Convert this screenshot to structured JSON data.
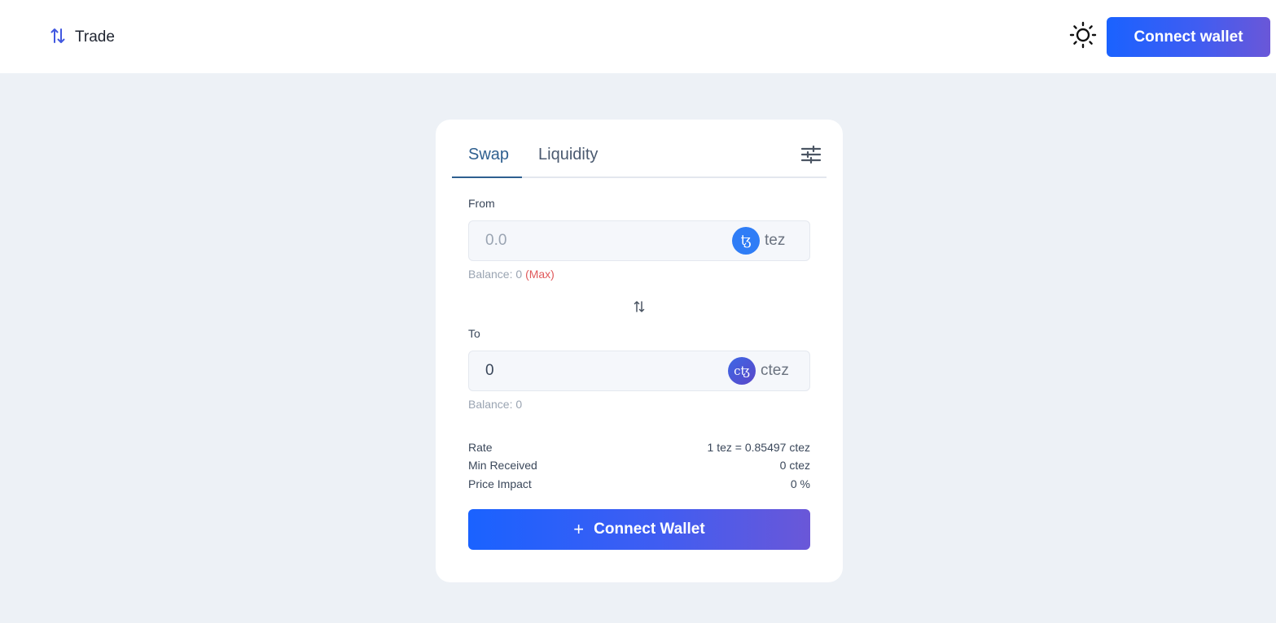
{
  "header": {
    "nav_trade": {
      "label": "Trade",
      "icon": "swap-arrows-icon"
    },
    "theme_icon": "sun-icon",
    "connect_label": "Connect wallet",
    "accent": "#1a62ff"
  },
  "card": {
    "tabs": [
      {
        "label": "Swap",
        "active": true
      },
      {
        "label": "Liquidity",
        "active": false
      }
    ],
    "settings_icon": "sliders-icon",
    "from": {
      "label": "From",
      "placeholder": "0.0",
      "value": "",
      "token": {
        "name": "tez",
        "logo_glyph": "ꜩ",
        "color": "#2f7df6"
      },
      "balance_label": "Balance: 0",
      "max_label": "(Max)"
    },
    "switch_icon": "swap-direction-icon",
    "to": {
      "label": "To",
      "placeholder": "0.0",
      "value": "0",
      "token": {
        "name": "ctez",
        "logo_glyph": "cꜩ",
        "color": "#4a52d8"
      },
      "balance_label": "Balance: 0"
    },
    "info": [
      {
        "key": "Rate",
        "value": "1 tez = 0.85497 ctez"
      },
      {
        "key": "Min Received",
        "value": "0 ctez"
      },
      {
        "key": "Price Impact",
        "value": "0 %"
      }
    ],
    "connect_button": {
      "icon": "+",
      "label": "Connect Wallet"
    }
  }
}
